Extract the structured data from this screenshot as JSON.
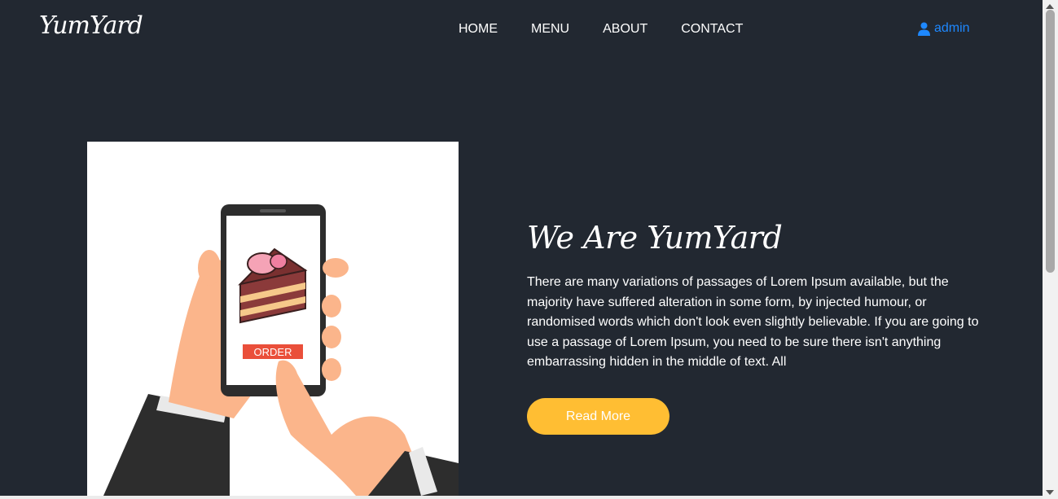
{
  "brand": "YumYard",
  "nav": {
    "items": [
      "HOME",
      "MENU",
      "ABOUT",
      "CONTACT"
    ]
  },
  "user": {
    "name": "admin",
    "icon": "user-icon"
  },
  "about": {
    "title": "We Are YumYard",
    "text": "There are many variations of passages of Lorem Ipsum available, but the majority have suffered alteration in some form, by injected humour, or randomised words which don't look even slightly believable. If you are going to use a passage of Lorem Ipsum, you need to be sure there isn't anything embarrassing hidden in the middle of text. All",
    "button": "Read More"
  },
  "illustration": {
    "order_label": "ORDER"
  },
  "colors": {
    "background": "#222831",
    "accent": "#ffbe33",
    "link": "#1e88ff"
  }
}
